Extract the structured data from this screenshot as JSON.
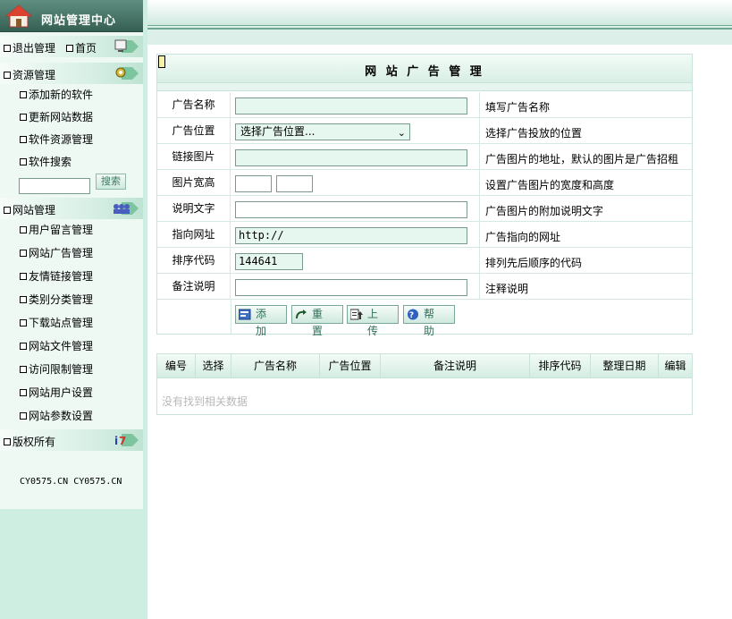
{
  "sidebar": {
    "title": "网站管理中心",
    "top_links": [
      "退出管理",
      "首页"
    ],
    "sections": [
      {
        "label": "资源管理",
        "items": [
          "添加新的软件",
          "更新网站数据",
          "软件资源管理",
          "软件搜索"
        ]
      },
      {
        "label": "网站管理",
        "items": [
          "用户留言管理",
          "网站广告管理",
          "友情链接管理",
          "类别分类管理",
          "下载站点管理",
          "网站文件管理",
          "访问限制管理",
          "网站用户设置",
          "网站参数设置"
        ]
      },
      {
        "label": "版权所有",
        "items": []
      }
    ],
    "search_button": "搜索",
    "search_value": "",
    "copyright": "CY0575.CN CY0575.CN"
  },
  "form": {
    "title": "网 站 广 告 管 理",
    "rows": [
      {
        "label": "广告名称",
        "desc": "填写广告名称",
        "value": ""
      },
      {
        "label": "广告位置",
        "desc": "选择广告投放的位置",
        "value": "选择广告位置..."
      },
      {
        "label": "链接图片",
        "desc": "广告图片的地址，默认的图片是广告招租",
        "value": ""
      },
      {
        "label": "图片宽高",
        "desc": "设置广告图片的宽度和高度",
        "value": ""
      },
      {
        "label": "说明文字",
        "desc": "广告图片的附加说明文字",
        "value": ""
      },
      {
        "label": "指向网址",
        "desc": "广告指向的网址",
        "value": "http://"
      },
      {
        "label": "排序代码",
        "desc": "排列先后顺序的代码",
        "value": "144641"
      },
      {
        "label": "备注说明",
        "desc": "注释说明",
        "value": ""
      }
    ],
    "buttons": [
      "添 加",
      "重 置",
      "上 传",
      "帮 助"
    ]
  },
  "list": {
    "columns": [
      "编号",
      "选择",
      "广告名称",
      "广告位置",
      "备注说明",
      "排序代码",
      "整理日期",
      "编辑"
    ],
    "empty_text": "没有找到相关数据"
  },
  "colors": {
    "accent": "#3a7a62",
    "sidebar_bg": "#cfeee2",
    "header_dark": "#355f52"
  }
}
